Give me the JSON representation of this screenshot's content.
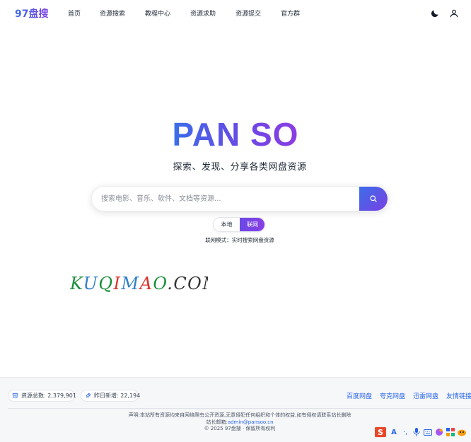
{
  "header": {
    "logo": "97盘搜",
    "nav": [
      "首页",
      "资源搜索",
      "教程中心",
      "资源求助",
      "资源提交",
      "官方群"
    ]
  },
  "hero": {
    "title": "PAN SO",
    "subtitle": "探索、发现、分享各类网盘资源"
  },
  "search": {
    "placeholder": "搜索电影、音乐、软件、文档等资源...",
    "value": ""
  },
  "mode": {
    "local_label": "本地",
    "web_label": "联网",
    "selected": "联网",
    "description": "联网模式：实时搜索网盘资源"
  },
  "watermark": "KUQIMAO.COM",
  "footer": {
    "stats": {
      "total": "资源总数: 2,379,901",
      "new": "昨日新增: 22,194"
    },
    "links": [
      "百度网盘",
      "夸克网盘",
      "迅雷网盘",
      "友情链接"
    ],
    "disclaimer": "声明:本站所有资源均来自网络爬虫公开资源,无意侵犯任何组织和个体的权益,如有侵权请联系站长删除",
    "email_label": "站长邮箱:",
    "email": "admin@pansoo.cn",
    "copyright": "© 2025 97盘搜 · 保留所有权利"
  },
  "colors": {
    "accent_start": "#3a6ee8",
    "accent_end": "#8b3de3",
    "link": "#2563eb"
  },
  "icons": [
    "moon-icon",
    "user-icon",
    "search-icon",
    "database-icon",
    "rocket-icon",
    "sogou-ime-icon"
  ]
}
